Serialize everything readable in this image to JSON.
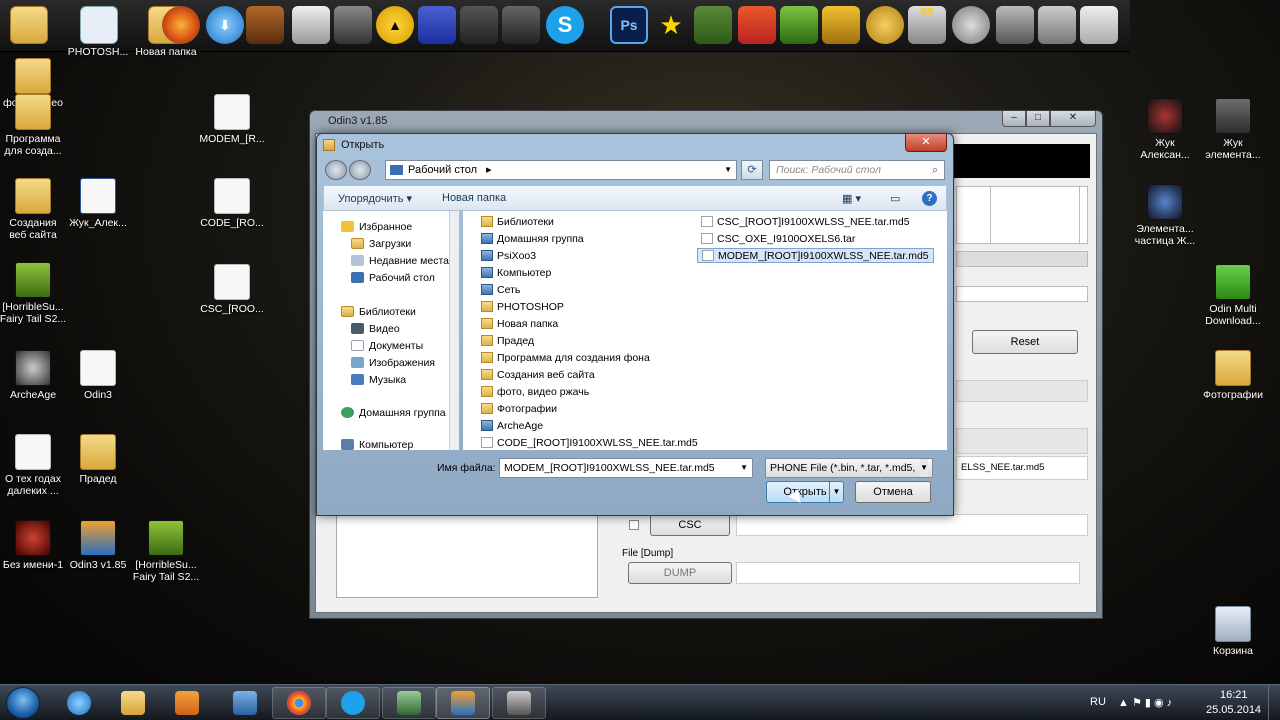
{
  "desktop_icons": [
    {
      "label": "фото, видео\nржачь"
    },
    {
      "label": "PHOTOSH..."
    },
    {
      "label": "Новая папка"
    },
    {
      "label": "Программа\nдля созда..."
    },
    {
      "label": "MODEM_[R..."
    },
    {
      "label": "Создания\nвеб сайта"
    },
    {
      "label": "Жук_Алек..."
    },
    {
      "label": "CODE_[RO..."
    },
    {
      "label": "[HorribleSu...\nFairy Tail S2..."
    },
    {
      "label": "CSC_[ROO..."
    },
    {
      "label": "ArcheAge"
    },
    {
      "label": "Odin3"
    },
    {
      "label": "О тех годах\nдалеких ..."
    },
    {
      "label": "Прадед"
    },
    {
      "label": "Без имени-1"
    },
    {
      "label": "Odin3 v1.85"
    },
    {
      "label": "[HorribleSu...\nFairy Tail S2..."
    },
    {
      "label": "Жук\nАлексан..."
    },
    {
      "label": "Жук\nэлемента..."
    },
    {
      "label": "Элемента...\nчастица Ж..."
    },
    {
      "label": "Odin Multi\nDownload..."
    },
    {
      "label": "Фотографии"
    },
    {
      "label": "Корзина"
    }
  ],
  "odin": {
    "title": "Odin3 v1.85",
    "reset_label": "Reset",
    "csc_label": "CSC",
    "file_dump_label": "File [Dump]",
    "dump_label": "DUMP",
    "phone_field_value_tail": "ELSS_NEE.tar.md5"
  },
  "dialog": {
    "title": "Открыть",
    "address": "Рабочий стол",
    "search_placeholder": "Поиск: Рабочий стол",
    "organize_label": "Упорядочить",
    "new_folder_label": "Новая папка",
    "nav": {
      "favorites": "Избранное",
      "downloads": "Загрузки",
      "recent": "Недавние места",
      "desktop": "Рабочий стол",
      "libraries": "Библиотеки",
      "video": "Видео",
      "documents": "Документы",
      "images": "Изображения",
      "music": "Музыка",
      "homegroup": "Домашняя группа",
      "computer": "Компьютер"
    },
    "files_col1": [
      "Библиотеки",
      "Домашняя группа",
      "PsiXoo3",
      "Компьютер",
      "Сеть",
      "PHOTOSHOP",
      "Новая папка",
      "Прадед",
      "Программа для создания фона",
      "Создания веб сайта",
      "фото, видео  ржачь",
      "Фотографии",
      "ArcheAge",
      "CODE_[ROOT]I9100XWLSS_NEE.tar.md5"
    ],
    "files_col2": [
      "CSC_[ROOT]I9100XWLSS_NEE.tar.md5",
      "CSC_OXE_I9100OXELS6.tar",
      "MODEM_[ROOT]I9100XWLSS_NEE.tar.md5"
    ],
    "filename_label": "Имя файла:",
    "filename_value": "MODEM_[ROOT]I9100XWLSS_NEE.tar.md5",
    "filter_value": "PHONE File (*.bin, *.tar, *.md5,",
    "open_label": "Открыть",
    "cancel_label": "Отмена"
  },
  "taskbar": {
    "lang": "RU",
    "time": "16:21",
    "date": "25.05.2014"
  },
  "toolbar_badge": "99"
}
